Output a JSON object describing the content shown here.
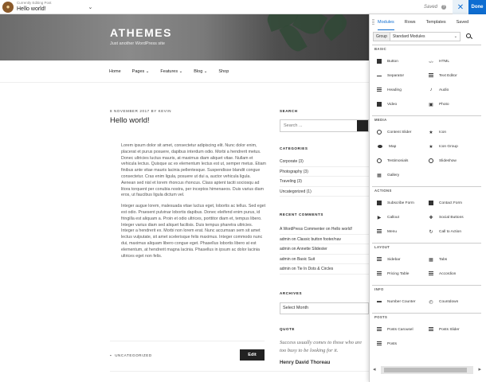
{
  "topbar": {
    "editing_label": "Currently Editing Post",
    "editing_title": "Hello world!",
    "history": "Saved",
    "close": "✕",
    "done": "Done"
  },
  "site": {
    "brand": "ATHEMES",
    "tagline": "Just another WordPress site",
    "nav": [
      "Home",
      "Pages ⌄",
      "Features ⌄",
      "Blog ⌄",
      "Shop"
    ]
  },
  "post": {
    "meta": "8 NOVEMBER 2017 BY KEVIN",
    "title": "Hello world!",
    "para1": "Lorem ipsum dolor sit amet, consectetur adipiscing elit. Nunc dolor enim, placerat et purus posuere, dapibus interdum odio. Morbi a hendrerit metus. Donec ultricies luctus mauris, at maximus diam aliquet vitae. Nullam et vehicula lectus. Quisque ac ex elementum lectus est ut, semper metus. Etiam finibus ante vitae mauris lacinia pellentesque. Suspendisse blandit congue consectetur. Cras enim ligula, posuere ut dui a, auctor vehicula ligula. Aenean sed nisl et lorem rhoncus rhoncus. Class aptent taciti sociosqu ad litora torquent per conubia nostra, per inceptos himenaeos. Duis varius diam eros, ut faucibus ligula dictum vel.",
    "para2": "Integer augue lorem, malesuada vitae luctus eget, lobortis ac tellus. Sed eget est odio. Praesent pulvinar lobortis dapibus. Donec eleifend enim purus, id fringilla est aliquam a. Proin et odio ultrices, porttitor diam et, tempus libero. Integer varius diam sed aliquet facilisis. Duis tempus pharetra ultricies. Integer a hendrerit ex. Morbi non lorem erat. Nunc accumsan sem sit amet lectus vulputate, sit amet scelerisque felis maximus. Integer commodo nunc dui, maximus aliquam libero congue eget. Phasellus lobortis libero at est elementum, at hendrerit magna lacinia. Phasellus in ipsum ac dolor lacinia ultrices eget non felis.",
    "category": "UNCATEGORIZED",
    "edit": "Edit"
  },
  "sidebar": {
    "search_title": "SEARCH",
    "search_placeholder": "Search ...",
    "categories_title": "CATEGORIES",
    "categories": [
      "Corporate (3)",
      "Photography (3)",
      "Traveling (3)",
      "Uncategorized (1)"
    ],
    "comments_title": "RECENT COMMENTS",
    "comments": [
      "A WordPress Commenter on Hello world!",
      "admin on Classic button footer/nav",
      "admin on Annette Slidester",
      "admin on Basic Suit",
      "admin on Tie In Dots & Circles"
    ],
    "archives_title": "ARCHIVES",
    "archives_select": "Select Month",
    "quote_title": "QUOTE",
    "quote": "Success usually comes to those who are too busy to be looking for it.",
    "quote_author": "Henry David Thoreau"
  },
  "panel": {
    "tabs": [
      "Modules",
      "Rows",
      "Templates",
      "Saved"
    ],
    "group_label": "Group",
    "group_value": "Standard Modules",
    "sections": [
      {
        "title": "BASIC",
        "items": [
          {
            "label": "Button",
            "icon": "button-icon"
          },
          {
            "label": "HTML",
            "icon": "code-icon"
          },
          {
            "label": "Separator",
            "icon": "separator-icon"
          },
          {
            "label": "Text Editor",
            "icon": "text-editor-icon"
          },
          {
            "label": "Heading",
            "icon": "heading-icon"
          },
          {
            "label": "Audio",
            "icon": "audio-icon"
          },
          {
            "label": "Video",
            "icon": "video-icon"
          },
          {
            "label": "Photo",
            "icon": "photo-icon"
          }
        ]
      },
      {
        "title": "MEDIA",
        "items": [
          {
            "label": "Content Slider",
            "icon": "content-slider-icon"
          },
          {
            "label": "Icon",
            "icon": "star-icon"
          },
          {
            "label": "Map",
            "icon": "map-pin-icon"
          },
          {
            "label": "Icon Group",
            "icon": "star-group-icon"
          },
          {
            "label": "Testimonials",
            "icon": "testimonials-icon"
          },
          {
            "label": "Slideshow",
            "icon": "slideshow-icon"
          },
          {
            "label": "Gallery",
            "icon": "gallery-icon"
          }
        ]
      },
      {
        "title": "ACTIONS",
        "items": [
          {
            "label": "Subscribe Form",
            "icon": "subscribe-icon"
          },
          {
            "label": "Contact Form",
            "icon": "contact-form-icon"
          },
          {
            "label": "Callout",
            "icon": "callout-icon"
          },
          {
            "label": "Social Buttons",
            "icon": "social-icon"
          },
          {
            "label": "Menu",
            "icon": "menu-icon"
          },
          {
            "label": "Call to Action",
            "icon": "cta-icon"
          }
        ]
      },
      {
        "title": "LAYOUT",
        "items": [
          {
            "label": "Sidebar",
            "icon": "sidebar-icon"
          },
          {
            "label": "Tabs",
            "icon": "tabs-icon"
          },
          {
            "label": "Pricing Table",
            "icon": "pricing-table-icon"
          },
          {
            "label": "Accordion",
            "icon": "accordion-icon"
          }
        ]
      },
      {
        "title": "INFO",
        "items": [
          {
            "label": "Number Counter",
            "icon": "counter-icon"
          },
          {
            "label": "Countdown",
            "icon": "countdown-icon"
          }
        ]
      },
      {
        "title": "POSTS",
        "items": [
          {
            "label": "Posts Carousel",
            "icon": "posts-carousel-icon"
          },
          {
            "label": "Posts Slider",
            "icon": "posts-slider-icon"
          },
          {
            "label": "Posts",
            "icon": "posts-icon"
          }
        ]
      }
    ]
  }
}
